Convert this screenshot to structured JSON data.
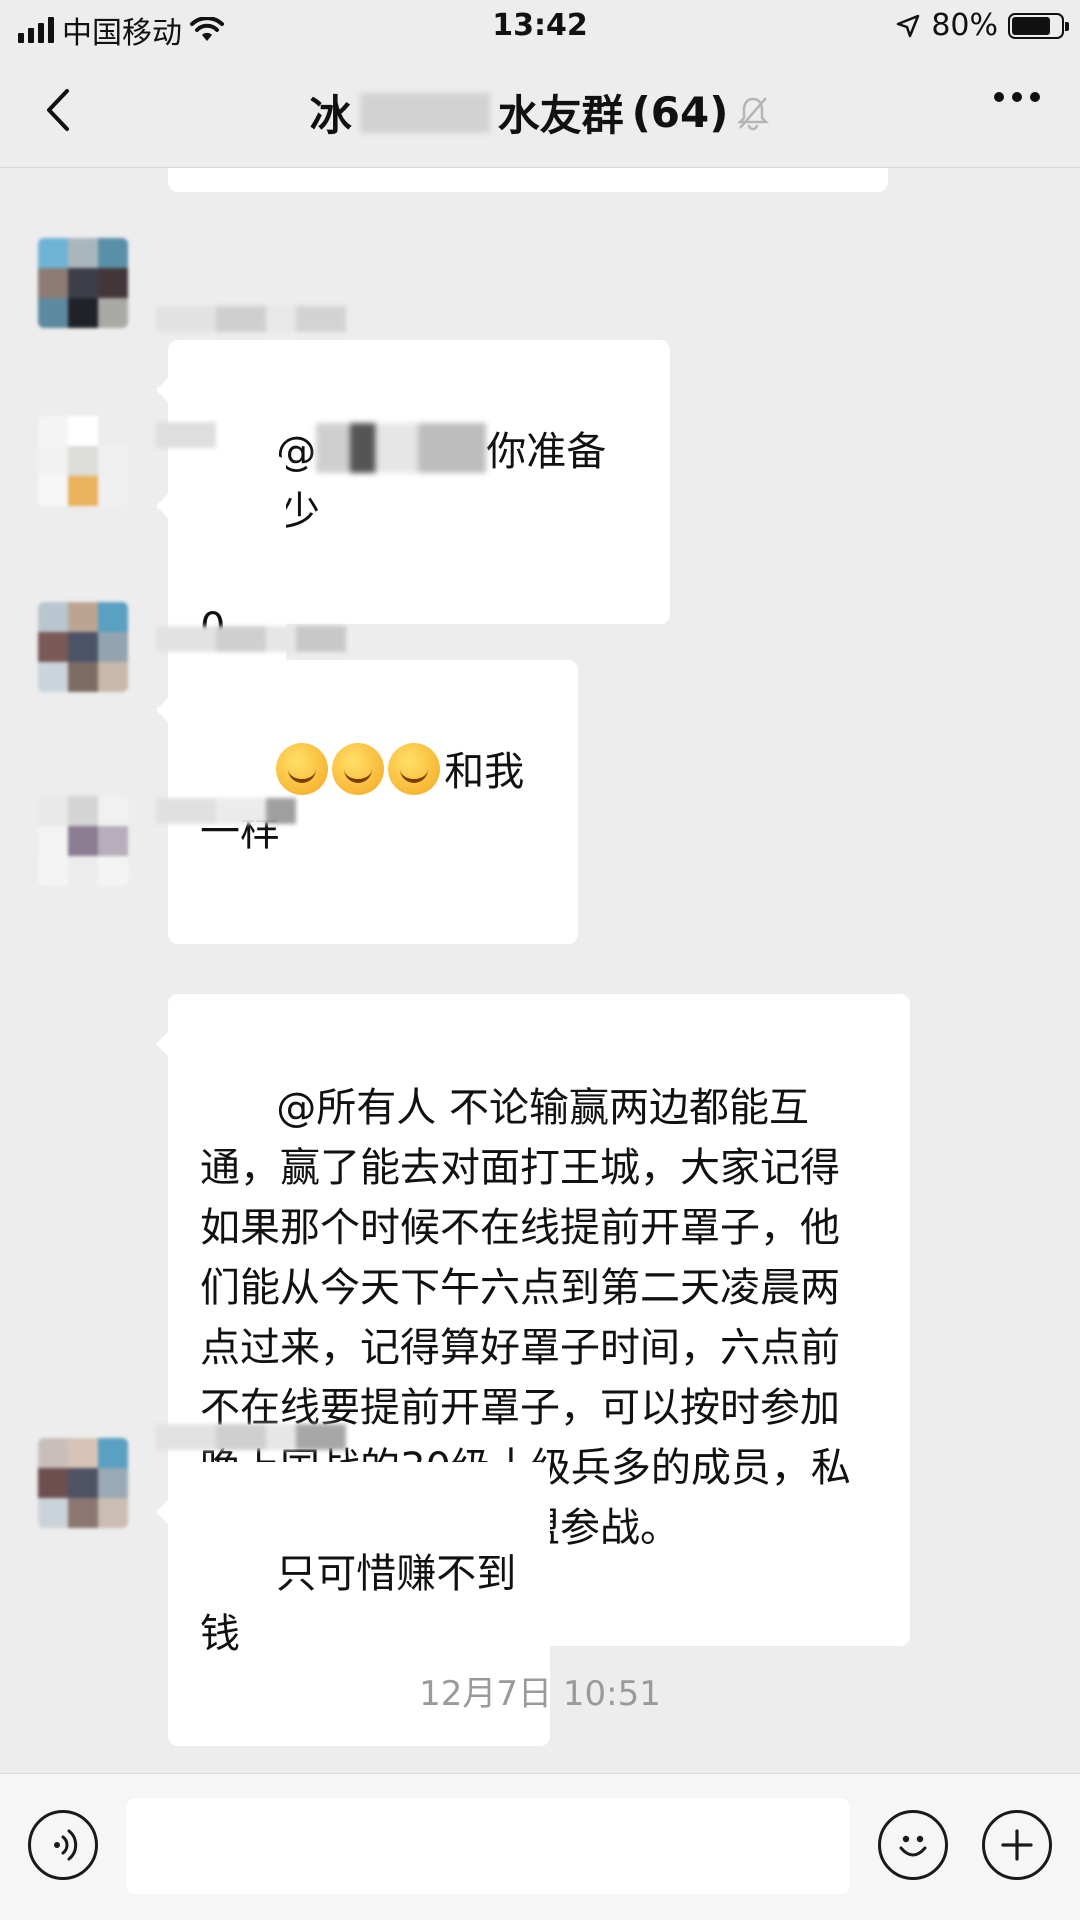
{
  "status_bar": {
    "carrier": "中国移动",
    "time": "13:42",
    "battery": "80%",
    "battery_level": 0.8
  },
  "nav": {
    "title_prefix": "冰",
    "title_suffix": "水友群",
    "member_count": "(64)",
    "back_icon": "chevron-left-icon",
    "mute_icon": "bell-muted-icon",
    "more_icon": "more-dots-icon"
  },
  "messages": [
    {
      "text_before": "@",
      "text_after": "你准备花多少"
    },
    {
      "text": "0"
    },
    {
      "text_after_emoji": "和我一样",
      "emoji_count": 3,
      "emoji_name": "facepalm-cry-emoji"
    },
    {
      "text": "@所有人 不论输赢两边都能互通，赢了能去对面打王城，大家记得如果那个时候不在线提前开罩子，他们能从今天下午六点到第二天凌晨两点过来，记得算好罩子时间，六点前不在线要提前开罩子，可以按时参加晚上国战的30级十级兵多的成员，私聊管理，报名进一盟参战。"
    },
    {
      "text": "只可惜赚不到钱"
    }
  ],
  "timestamp": "12月7日 10:51",
  "input_bar": {
    "voice_icon": "voice-icon",
    "emoji_icon": "emoji-icon",
    "plus_icon": "plus-icon",
    "input_value": ""
  },
  "colors": {
    "background": "#ededed",
    "bubble": "#ffffff",
    "timestamp": "#9a9a9a"
  }
}
